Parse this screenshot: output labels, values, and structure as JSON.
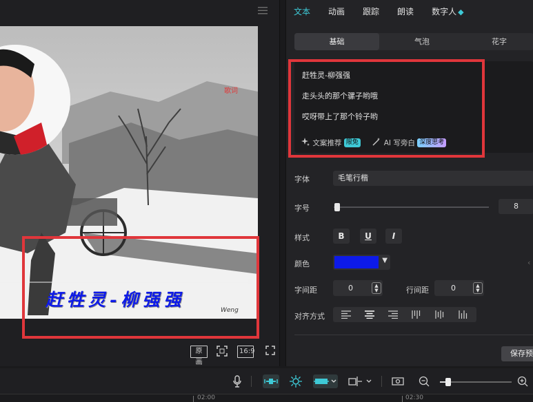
{
  "preview": {
    "menu_icon": "hamburger-icon",
    "watermark": "歌词",
    "subtitle_overlay": "赶牲灵-柳强强",
    "signature": "Weng",
    "buttons": {
      "original": "原画",
      "fullscreen_icon": "screen-fit-icon",
      "ratio": "16:9",
      "expand_icon": "expand-icon"
    }
  },
  "tabs": [
    "文本",
    "动画",
    "跟踪",
    "朗读",
    "数字人"
  ],
  "active_tab": "文本",
  "sub_tabs": [
    "基础",
    "气泡",
    "花字"
  ],
  "text_box": {
    "lines": [
      "赶牲灵-柳强强",
      "走头头的那个骡子哟哦",
      "哎呀带上了那个铃子哟"
    ],
    "copy_suggest": "文案推荐",
    "free_badge": "限免",
    "ai_write": "AI 写旁白",
    "deep_badge": "深度思考"
  },
  "properties": {
    "font_label": "字体",
    "font_value": "毛笔行楷",
    "size_label": "字号",
    "size_value": "8",
    "size_fraction": 0.02,
    "style_label": "样式",
    "style_buttons": [
      "B",
      "U",
      "I"
    ],
    "color_label": "颜色",
    "color_value": "#0d1ae8",
    "char_spacing_label": "字间距",
    "char_spacing_value": "0",
    "line_spacing_label": "行间距",
    "line_spacing_value": "0",
    "align_label": "对齐方式",
    "save_preset": "保存预设"
  },
  "timeline": {
    "ruler_labels": [
      "02:00",
      "02:30"
    ]
  },
  "colors": {
    "accent": "#3ec9d6",
    "highlight_red": "#e0363b",
    "text_blue": "#0d1ae8"
  }
}
